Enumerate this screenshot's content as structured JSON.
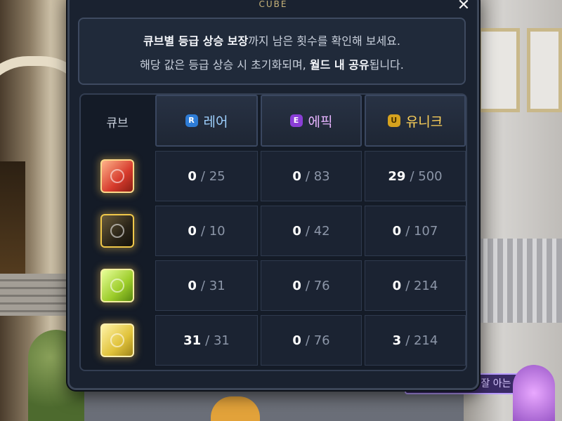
{
  "dialog": {
    "title": "CUBE",
    "close_icon": "✕"
  },
  "notice": {
    "line1_bold": "큐브별 등급 상승 보장",
    "line1_rest": "까지 남은 횟수를 확인해 보세요.",
    "line2_pre": "해당 값은 등급 상승 시 초기화되며, ",
    "line2_bold": "월드 내 공유",
    "line2_post": "됩니다."
  },
  "table": {
    "header_cube": "큐브",
    "grades": [
      {
        "label": "레어",
        "badge": "R",
        "color": "#9fd1ff"
      },
      {
        "label": "에픽",
        "badge": "E",
        "color": "#e6b3ff"
      },
      {
        "label": "유니크",
        "badge": "U",
        "color": "#ffd25a"
      }
    ],
    "rows": [
      {
        "cube_icon": "red-cube-icon",
        "values": [
          {
            "cur": "0",
            "max": "/ 25"
          },
          {
            "cur": "0",
            "max": "/ 83"
          },
          {
            "cur": "29",
            "max": "/ 500"
          }
        ]
      },
      {
        "cube_icon": "black-cube-icon",
        "values": [
          {
            "cur": "0",
            "max": "/ 10"
          },
          {
            "cur": "0",
            "max": "/ 42"
          },
          {
            "cur": "0",
            "max": "/ 107"
          }
        ]
      },
      {
        "cube_icon": "green-cube-icon",
        "values": [
          {
            "cur": "0",
            "max": "/ 31"
          },
          {
            "cur": "0",
            "max": "/ 76"
          },
          {
            "cur": "0",
            "max": "/ 214"
          }
        ]
      },
      {
        "cube_icon": "yellow-cube-icon",
        "values": [
          {
            "cur": "31",
            "max": "/ 31"
          },
          {
            "cur": "0",
            "max": "/ 76"
          },
          {
            "cur": "3",
            "max": "/ 214"
          }
        ]
      }
    ]
  },
  "background": {
    "npc_tag": "베이블을 잘 아는"
  }
}
